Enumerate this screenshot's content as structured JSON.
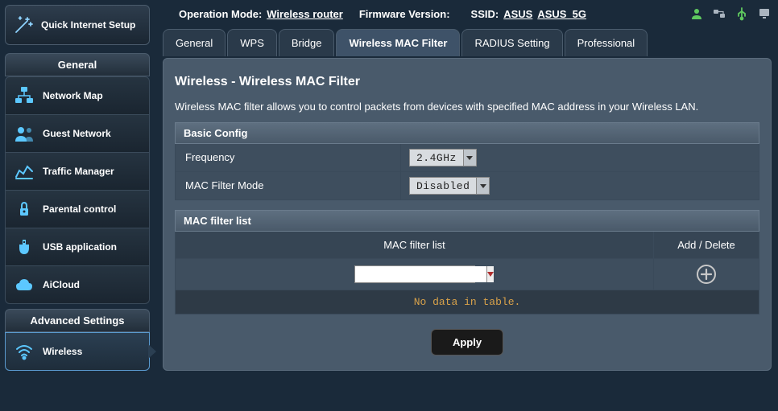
{
  "topbar": {
    "operation_mode_label": "Operation Mode:",
    "operation_mode_value": "Wireless router",
    "firmware_label": "Firmware Version:",
    "ssid_label": "SSID:",
    "ssid_1": "ASUS",
    "ssid_2": "ASUS_5G"
  },
  "sidebar": {
    "qis_label": "Quick Internet Setup",
    "general_header": "General",
    "general_items": [
      {
        "label": "Network Map"
      },
      {
        "label": "Guest Network"
      },
      {
        "label": "Traffic Manager"
      },
      {
        "label": "Parental control"
      },
      {
        "label": "USB application"
      },
      {
        "label": "AiCloud"
      }
    ],
    "advanced_header": "Advanced Settings",
    "advanced_items": [
      {
        "label": "Wireless"
      }
    ]
  },
  "tabs": [
    {
      "label": "General"
    },
    {
      "label": "WPS"
    },
    {
      "label": "Bridge"
    },
    {
      "label": "Wireless MAC Filter"
    },
    {
      "label": "RADIUS Setting"
    },
    {
      "label": "Professional"
    }
  ],
  "page": {
    "title": "Wireless - Wireless MAC Filter",
    "description": "Wireless MAC filter allows you to control packets from devices with specified MAC address in your Wireless LAN."
  },
  "basic_config": {
    "header": "Basic Config",
    "frequency_label": "Frequency",
    "frequency_value": "2.4GHz",
    "mode_label": "MAC Filter Mode",
    "mode_value": "Disabled"
  },
  "mac_list": {
    "header": "MAC filter list",
    "col_main": "MAC filter list",
    "col_act": "Add / Delete",
    "input_value": "",
    "empty_text": "No data in table."
  },
  "apply_label": "Apply"
}
